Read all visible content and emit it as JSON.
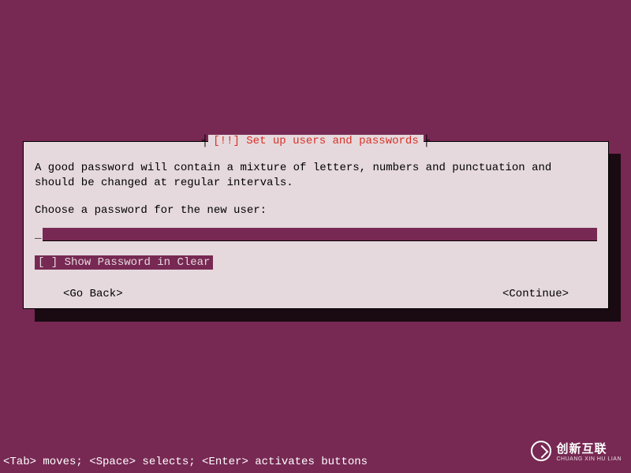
{
  "dialog": {
    "title_mark": "[!!]",
    "title_text": "Set up users and passwords",
    "description": "A good password will contain a mixture of letters, numbers and punctuation and should be changed at regular intervals.",
    "prompt": "Choose a password for the new user:",
    "password_value": "",
    "checkbox": {
      "state": "[ ]",
      "label": "Show Password in Clear"
    },
    "buttons": {
      "back": "<Go Back>",
      "continue": "<Continue>"
    }
  },
  "footer": "<Tab> moves; <Space> selects; <Enter> activates buttons",
  "logo": {
    "name": "创新互联",
    "sub": "CHUANG XIN HU LIAN"
  }
}
